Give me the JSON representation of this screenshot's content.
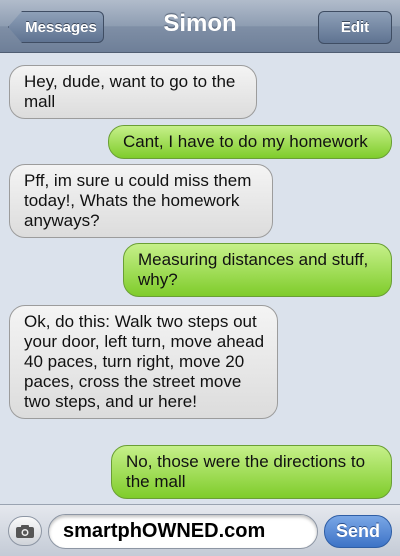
{
  "header": {
    "back_label": "Messages",
    "title": "Simon",
    "edit_label": "Edit"
  },
  "messages": [
    {
      "from": "them",
      "text": "Hey, dude, want to go to the mall"
    },
    {
      "from": "me",
      "text": "Cant, I have to do my homework"
    },
    {
      "from": "them",
      "text": "Pff, im sure u could miss them today!, Whats the homework anyways?"
    },
    {
      "from": "me",
      "text": "Measuring distances and stuff, why?"
    },
    {
      "from": "them",
      "text": "Ok, do this: Walk two steps out your door, left turn, move ahead 40 paces, turn right, move 20 paces, cross the street move two steps, and ur here!"
    },
    {
      "from": "me",
      "text": "No, those were the directions to the mall"
    }
  ],
  "composer": {
    "camera_icon": "camera-icon",
    "input_value": "smartphOWNED.com",
    "send_label": "Send"
  },
  "colors": {
    "incoming_bubble": "#e6e6e6",
    "outgoing_bubble": "#8fd63c",
    "send_button": "#3d73c6",
    "background": "#dbe2ec"
  }
}
